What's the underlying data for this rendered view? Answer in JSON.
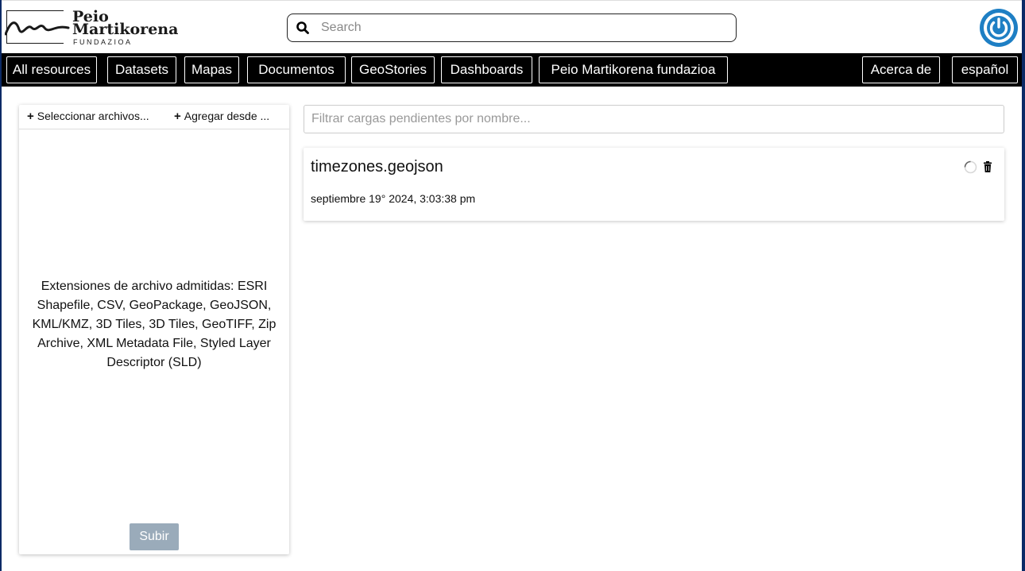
{
  "header": {
    "logo": {
      "line1": "Peio",
      "line2": "Martikorena",
      "sub": "FUNDAZIOA"
    },
    "search": {
      "placeholder": "Search",
      "value": ""
    },
    "icons": {
      "search": "search-icon",
      "power": "power-icon"
    },
    "accent_color": "#1e7fc4"
  },
  "nav": {
    "items": [
      {
        "label": "All resources"
      },
      {
        "label": "Datasets"
      },
      {
        "label": "Mapas"
      },
      {
        "label": "Documentos"
      },
      {
        "label": "GeoStories"
      },
      {
        "label": "Dashboards"
      },
      {
        "label": "Peio Martikorena fundazioa"
      }
    ],
    "right_items": [
      {
        "label": "Acerca de"
      },
      {
        "label": "español"
      }
    ]
  },
  "upload_panel": {
    "select_files_label": "Seleccionar archivos...",
    "add_from_label": "Agregar desde ...",
    "supported_text": "Extensiones de archivo admitidas: ESRI Shapefile, CSV, GeoPackage, GeoJSON, KML/KMZ, 3D Tiles, 3D Tiles, GeoTIFF, Zip Archive, XML Metadata File, Styled Layer Descriptor (SLD)",
    "upload_button": "Subir",
    "upload_button_color": "#9aabba"
  },
  "pending": {
    "filter_placeholder": "Filtrar cargas pendientes por nombre...",
    "items": [
      {
        "name": "timezones.geojson",
        "date": "septiembre 19° 2024, 3:03:38 pm",
        "status_icon": "spinner-icon",
        "delete_icon": "trash-icon"
      }
    ]
  }
}
